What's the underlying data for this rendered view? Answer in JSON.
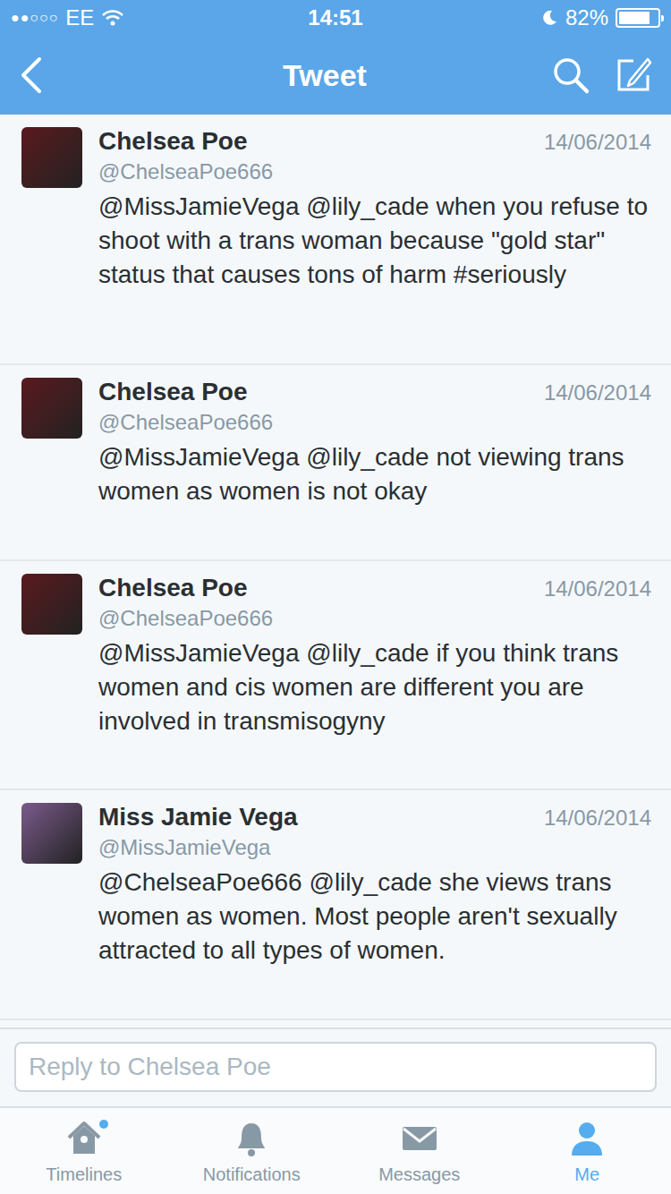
{
  "status_bar": {
    "signal": "●●○○○",
    "carrier": "EE",
    "time": "14:51",
    "battery": "82%",
    "battery_level": 0.82
  },
  "nav": {
    "title": "Tweet"
  },
  "tweets": [
    {
      "name": "Chelsea Poe",
      "handle": "@ChelseaPoe666",
      "date": "14/06/2014",
      "text": "@MissJamieVega @lily_cade when you refuse to shoot with a trans woman because \"gold star\" status that causes tons of harm #seriously",
      "color": "#5a1a1e"
    },
    {
      "name": "Chelsea Poe",
      "handle": "@ChelseaPoe666",
      "date": "14/06/2014",
      "text": "@MissJamieVega @lily_cade not viewing trans women as women is not okay",
      "color": "#5a1a1e"
    },
    {
      "name": "Chelsea Poe",
      "handle": "@ChelseaPoe666",
      "date": "14/06/2014",
      "text": "@MissJamieVega @lily_cade if you think trans women and cis women are different you are involved in transmisogyny",
      "color": "#5a1a1e"
    },
    {
      "name": "Miss Jamie Vega",
      "handle": "@MissJamieVega",
      "date": "14/06/2014",
      "text": "@ChelseaPoe666 @lily_cade she views trans women as women. Most people aren't sexually attracted to all types of women.",
      "color": "#7b5a8c"
    }
  ],
  "reply": {
    "placeholder": "Reply to Chelsea Poe"
  },
  "tabs": [
    {
      "label": "Timelines",
      "selected": false,
      "badge": true,
      "kind": "home"
    },
    {
      "label": "Notifications",
      "selected": false,
      "badge": false,
      "kind": "bell"
    },
    {
      "label": "Messages",
      "selected": false,
      "badge": false,
      "kind": "mail"
    },
    {
      "label": "Me",
      "selected": true,
      "badge": false,
      "kind": "person"
    }
  ]
}
